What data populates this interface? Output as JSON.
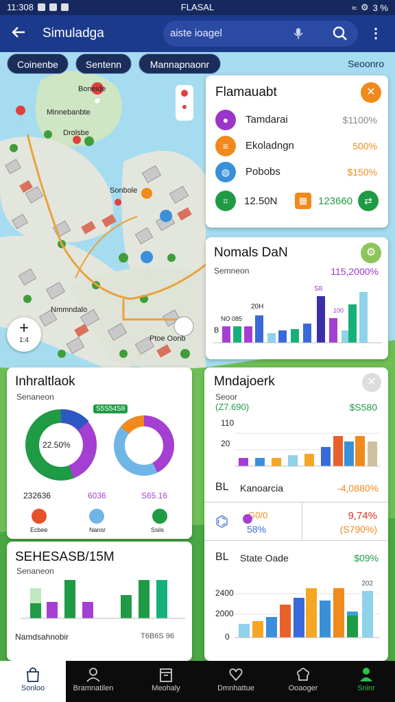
{
  "status_bar": {
    "time": "11:308",
    "center": "FLASAL",
    "battery": "3 %"
  },
  "app_bar": {
    "title": "Simuladga",
    "search_query": "aiste ioagel"
  },
  "chips": [
    "Coinenbe",
    "Sentenn",
    "Mannapnaonr"
  ],
  "chip_right": "Seoonro",
  "map_labels": [
    "Boneide",
    "Minnebanbte",
    "Drolsbe",
    "Sonbole",
    "Nmmndalo",
    "Ptoe Oonb"
  ],
  "zoom_level": "1:4",
  "card_a": {
    "title": "Flamauabt",
    "rows": [
      {
        "icon": "person-icon",
        "color": "#9c35c9",
        "label": "Tamdarai",
        "value": "$1100%",
        "value_color": "#888888"
      },
      {
        "icon": "list-icon",
        "color": "#f08a1c",
        "label": "Ekoladngn",
        "value": "500%",
        "value_color": "#f08a1c"
      },
      {
        "icon": "globe-icon",
        "color": "#3a8fd9",
        "label": "Pobobs",
        "value": "$150%",
        "value_color": "#f08a1c"
      }
    ],
    "footer_left": "12.50N",
    "footer_right": "123660"
  },
  "card_b": {
    "title": "Nomals DaN",
    "sub": "Semneon",
    "value": "115,2000%",
    "labels": [
      "S8",
      "20H",
      "NO 085",
      "100",
      "B"
    ]
  },
  "card_c": {
    "title": "Inhraltlaok",
    "sub": "Senaneon",
    "badge": "S5S54S8",
    "center": "22.50%",
    "stats": [
      "232636",
      "6036",
      "S65.16"
    ],
    "legend": [
      "Ecbee",
      "Nansr",
      "Ssiis"
    ]
  },
  "card_d": {
    "title": "SEHESASB/15M",
    "sub": "Senaneon",
    "foot_left": "Namdsahnobir",
    "foot_right": "T6B6S 96"
  },
  "card_e": {
    "title": "Mndajoerk",
    "sub": "Seoor",
    "value_left": "(Z7.690)",
    "value_right": "$S580",
    "y_ticks": [
      "110",
      "20"
    ],
    "row1": {
      "left": "BL",
      "label": "Kanoarcia",
      "value": "-4,0880%"
    },
    "row2": {
      "top": "G0/0",
      "pct": "58%",
      "r1": "9,74%",
      "r2": "(S790%)"
    },
    "row3": {
      "left": "BL",
      "label": "State Oade",
      "value": "$09%"
    },
    "y_ticks2": [
      "2400",
      "2000",
      "0"
    ],
    "corner": "202"
  },
  "bottom_nav": [
    "Sonloo",
    "Bramnatilen",
    "Meohaly",
    "Dmnhattue",
    "Ooaoger",
    "Sninr"
  ],
  "colors": {
    "app_bar": "#1c3a8c",
    "status_bar": "#15295f",
    "green": "#1f9a45",
    "purple": "#a53fd1",
    "orange": "#f08a1c",
    "blue": "#3a8fd9"
  }
}
